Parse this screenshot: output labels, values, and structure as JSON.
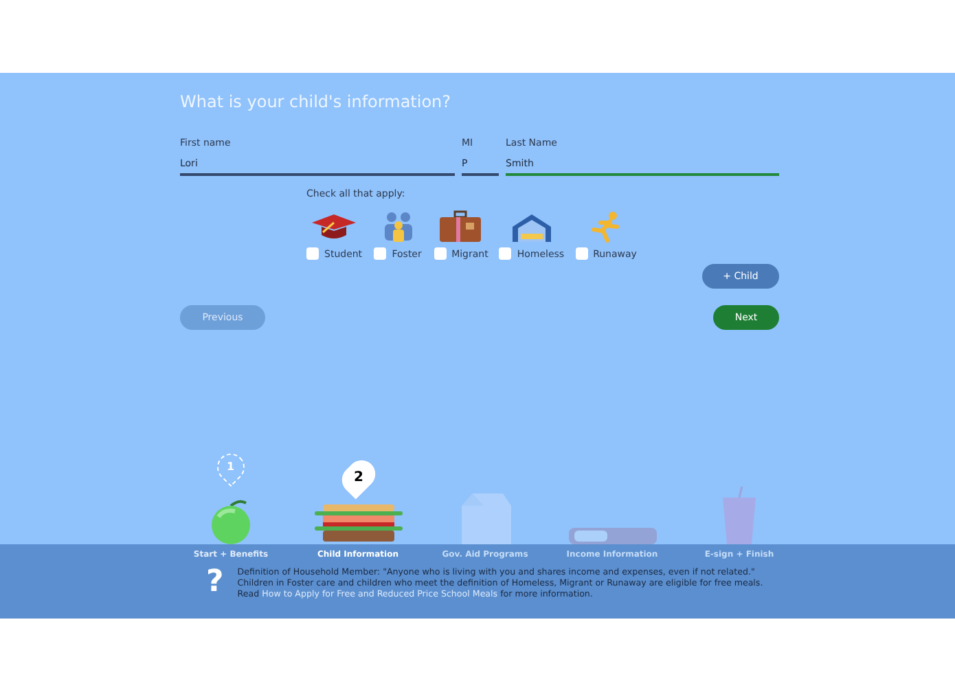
{
  "heading": "What is your child's information?",
  "fields": [
    {
      "label": "First name",
      "value": "Lori",
      "focused": false
    },
    {
      "label": "MI",
      "value": "P",
      "focused": false
    },
    {
      "label": "Last Name",
      "value": "Smith",
      "focused": true
    }
  ],
  "checks_label": "Check all that apply:",
  "statuses": [
    {
      "kind": "student",
      "label": "Student",
      "checked": false
    },
    {
      "kind": "foster",
      "label": "Foster",
      "checked": false
    },
    {
      "kind": "migrant",
      "label": "Migrant",
      "checked": false
    },
    {
      "kind": "homeless",
      "label": "Homeless",
      "checked": false
    },
    {
      "kind": "runaway",
      "label": "Runaway",
      "checked": false
    }
  ],
  "add_child": "+ Child",
  "previous": "Previous",
  "next": "Next",
  "steps": [
    {
      "kind": "apple",
      "label": "Start + Benefits",
      "number": "1",
      "completed": true,
      "selected": false
    },
    {
      "kind": "sandwich",
      "label": "Child Information",
      "number": "2",
      "completed": false,
      "selected": true
    },
    {
      "kind": "milk",
      "label": "Gov. Aid Programs",
      "completed": false,
      "selected": false
    },
    {
      "kind": "tray",
      "label": "Income Information",
      "completed": false,
      "selected": false
    },
    {
      "kind": "cup",
      "label": "E-sign + Finish",
      "completed": false,
      "selected": false
    }
  ],
  "help": {
    "icon": "?",
    "text": "Definition of Household Member: \"Anyone who is living with you and shares income and expenses, even if not related.\" Children in Foster care and children who meet the definition of Homeless, Migrant or Runaway are eligible for free meals. Read",
    "link": "How to Apply for Free and Reduced Price School Meals",
    "after": "for more information."
  }
}
